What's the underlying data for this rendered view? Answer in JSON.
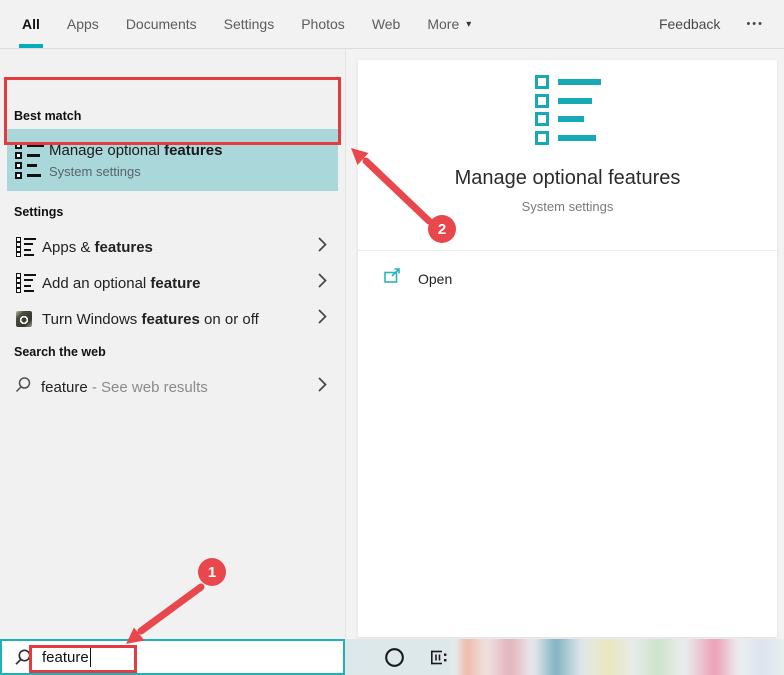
{
  "colors": {
    "accent_teal": "#17aab4",
    "search_border_teal": "#1fb0ba",
    "highlight_teal": "#a9d7da",
    "annotation_red": "#e8474b",
    "annotation_box_red": "#e23c41"
  },
  "topbar": {
    "tabs": [
      "All",
      "Apps",
      "Documents",
      "Settings",
      "Photos",
      "Web"
    ],
    "more_label": "More",
    "dropdown_glyph": "▾",
    "feedback_label": "Feedback",
    "ellipsis_glyph": "•••"
  },
  "left_panel": {
    "best_match_header": "Best match",
    "best_match": {
      "title_prefix": "Manage optional ",
      "title_match": "features",
      "subtitle": "System settings"
    },
    "settings_header": "Settings",
    "settings_items": [
      {
        "prefix": "Apps & ",
        "match": "features",
        "suffix": ""
      },
      {
        "prefix": "Add an optional ",
        "match": "feature",
        "suffix": ""
      },
      {
        "prefix": "Turn Windows ",
        "match": "features",
        "suffix": " on or off"
      }
    ],
    "web_header": "Search the web",
    "web_result": {
      "term": "feature",
      "rest": "- See web results"
    }
  },
  "preview_panel": {
    "title": "Manage optional features",
    "subtitle": "System settings",
    "open_label": "Open"
  },
  "search_box": {
    "value": "feature"
  },
  "annotations": {
    "step1": "1",
    "step2": "2"
  }
}
